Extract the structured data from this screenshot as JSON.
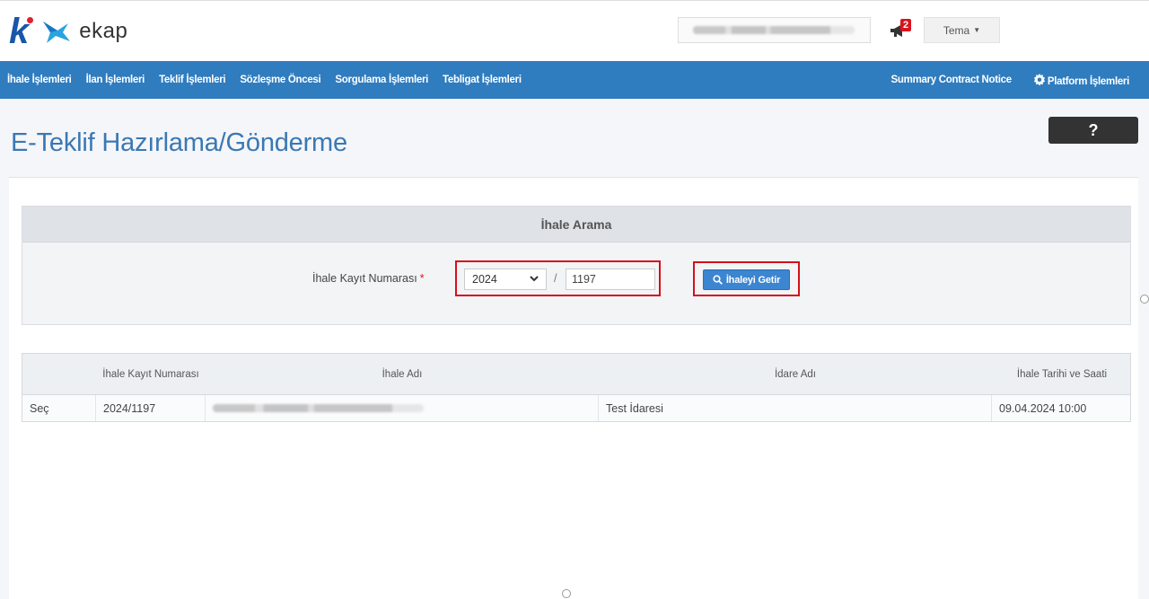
{
  "header": {
    "logo_text": "ekap",
    "user_name": "",
    "notification_count": "2",
    "theme_label": "Tema"
  },
  "nav": {
    "items": [
      "İhale İşlemleri",
      "İlan İşlemleri",
      "Teklif İşlemleri",
      "Sözleşme Öncesi",
      "Sorgulama İşlemleri",
      "Tebligat İşlemleri"
    ],
    "summary_link": "Summary Contract Notice",
    "platform_label": "Platform İşlemleri"
  },
  "page": {
    "title": "E-Teklif Hazırlama/Gönderme",
    "help_label": "?"
  },
  "search": {
    "heading": "İhale Arama",
    "field_label": "İhale Kayıt Numarası",
    "required_mark": "*",
    "year_value": "2024",
    "separator": "/",
    "number_value": "1197",
    "button_label": "İhaleyi Getir"
  },
  "table": {
    "columns": [
      "",
      "İhale Kayıt Numarası",
      "İhale Adı",
      "İdare Adı",
      "İhale Tarihi ve Saati"
    ],
    "rows": [
      {
        "action": "Seç",
        "record_no": "2024/1197",
        "name": "",
        "authority": "Test İdaresi",
        "date": "09.04.2024 10:00"
      }
    ]
  },
  "colors": {
    "nav_bg": "#2f7cbf",
    "title": "#3b78b3",
    "highlight": "#d4101a",
    "button": "#3c85d0"
  },
  "icons": [
    "megaphone-icon",
    "gear-icon",
    "search-icon",
    "chevron-down-icon"
  ]
}
